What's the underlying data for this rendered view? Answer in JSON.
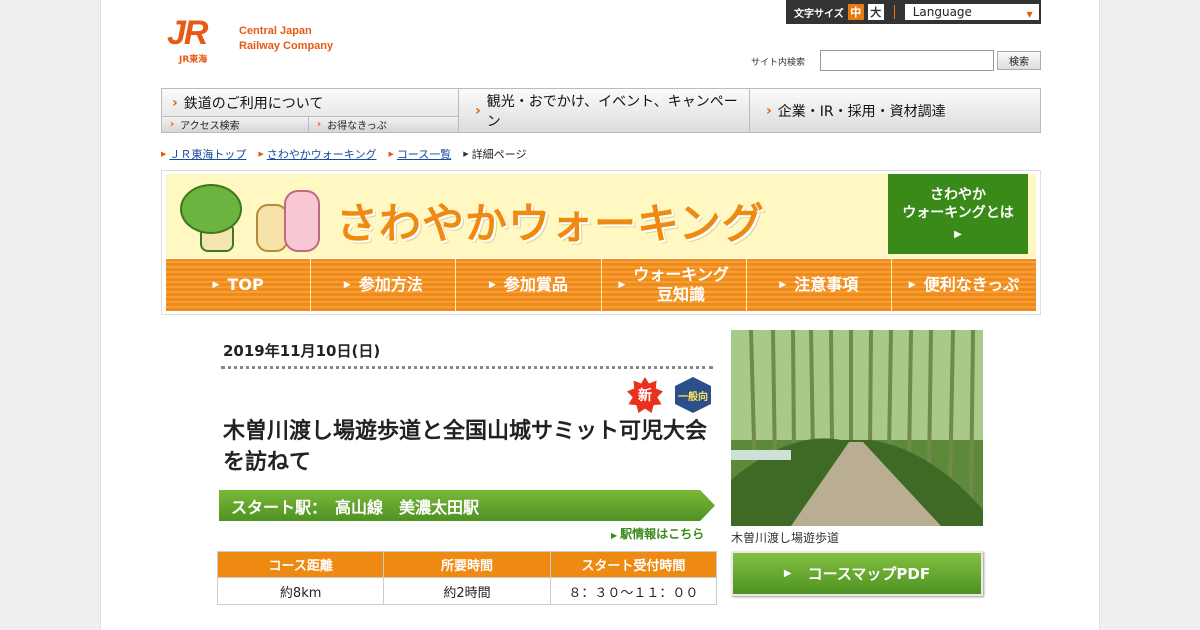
{
  "header": {
    "logo_text": "JR",
    "logo_subtext": "JR東海",
    "company_name_line1": "Central Japan",
    "company_name_line2": "Railway Company",
    "font_size_label": "文字サイズ",
    "font_size_medium": "中",
    "font_size_large": "大",
    "language_label": "Language",
    "search_label": "サイト内検索",
    "search_value": "",
    "search_button": "検索"
  },
  "global_nav": {
    "railway": "鉄道のご利用について",
    "railway_sub1": "アクセス検索",
    "railway_sub2": "お得なきっぷ",
    "tourism": "観光・おでかけ、イベント、キャンペーン",
    "corporate": "企業・IR・採用・資材調達"
  },
  "breadcrumb": {
    "items": [
      "ＪＲ東海トップ",
      "さわやかウォーキング",
      "コース一覧"
    ],
    "current": "詳細ページ"
  },
  "banner": {
    "title": "さわやかウォーキング",
    "about_line1": "さわやか",
    "about_line2": "ウォーキングとは",
    "nav": {
      "top": "TOP",
      "how_to_join": "参加方法",
      "prizes": "参加賞品",
      "tips_line1": "ウォーキング",
      "tips_line2": "豆知識",
      "notes": "注意事項",
      "tickets": "便利なきっぷ"
    }
  },
  "course": {
    "date": "2019年11月10日(日)",
    "badge_new": "新",
    "badge_general": "一般向",
    "title": "木曽川渡し場遊歩道と全国山城サミット可児大会を訪ねて",
    "start_station": "スタート駅：　高山線　美濃太田駅",
    "station_info_link": "駅情報はこちら",
    "table_headers": [
      "コース距離",
      "所要時間",
      "スタート受付時間"
    ],
    "table_values": [
      "約8km",
      "約2時間",
      "８：３０～１１：００"
    ],
    "photo_caption": "木曽川渡し場遊歩道",
    "map_pdf_button": "コースマップPDF"
  },
  "colors": {
    "brand_orange": "#e85a13",
    "accent_orange": "#ee8a12",
    "accent_green": "#4e9222"
  }
}
